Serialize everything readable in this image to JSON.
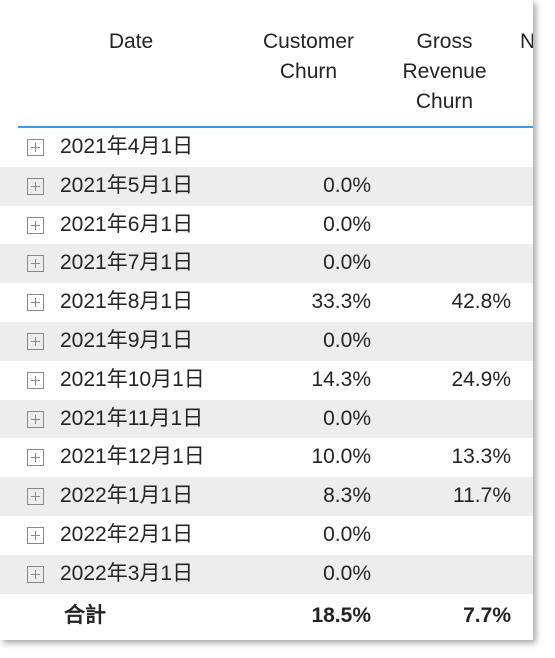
{
  "table": {
    "columns": [
      {
        "key": "date",
        "label": "Date",
        "align": "left"
      },
      {
        "key": "customer_churn",
        "label": "Customer Churn",
        "align": "right"
      },
      {
        "key": "gross_revenue_churn",
        "label": "Gross Revenue Churn",
        "align": "right"
      },
      {
        "key": "net_revenue_churn",
        "label": "N",
        "align": "right"
      }
    ],
    "expander_icon": "plus-box-icon",
    "rows": [
      {
        "date": "2021年4月1日",
        "customer_churn": "",
        "gross_revenue_churn": ""
      },
      {
        "date": "2021年5月1日",
        "customer_churn": "0.0%",
        "gross_revenue_churn": ""
      },
      {
        "date": "2021年6月1日",
        "customer_churn": "0.0%",
        "gross_revenue_churn": ""
      },
      {
        "date": "2021年7月1日",
        "customer_churn": "0.0%",
        "gross_revenue_churn": ""
      },
      {
        "date": "2021年8月1日",
        "customer_churn": "33.3%",
        "gross_revenue_churn": "42.8%"
      },
      {
        "date": "2021年9月1日",
        "customer_churn": "0.0%",
        "gross_revenue_churn": ""
      },
      {
        "date": "2021年10月1日",
        "customer_churn": "14.3%",
        "gross_revenue_churn": "24.9%"
      },
      {
        "date": "2021年11月1日",
        "customer_churn": "0.0%",
        "gross_revenue_churn": ""
      },
      {
        "date": "2021年12月1日",
        "customer_churn": "10.0%",
        "gross_revenue_churn": "13.3%"
      },
      {
        "date": "2022年1月1日",
        "customer_churn": "8.3%",
        "gross_revenue_churn": "11.7%"
      },
      {
        "date": "2022年2月1日",
        "customer_churn": "0.0%",
        "gross_revenue_churn": ""
      },
      {
        "date": "2022年3月1日",
        "customer_churn": "0.0%",
        "gross_revenue_churn": ""
      }
    ],
    "total": {
      "date": "合計",
      "customer_churn": "18.5%",
      "gross_revenue_churn": "7.7%"
    }
  },
  "colors": {
    "header_rule": "#3E9BE0",
    "column_divider": "#A8CDF0",
    "row_stripe": "#EDEDED",
    "text": "#252423",
    "expander_border": "#8A8886"
  }
}
